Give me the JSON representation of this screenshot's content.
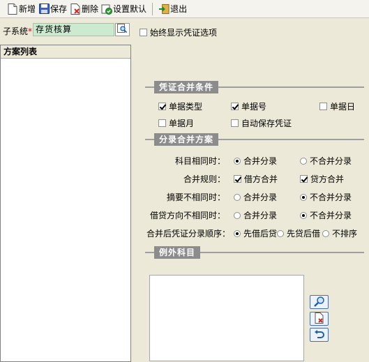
{
  "toolbar": {
    "new_label": "新增",
    "save_label": "保存",
    "delete_label": "删除",
    "set_default_label": "设置默认",
    "exit_label": "退出"
  },
  "subsystem": {
    "label": "子系统",
    "required_mark": "*",
    "value": "存货核算"
  },
  "always_show": {
    "label": "始终显示凭证选项",
    "checked": false
  },
  "plan_list": {
    "header": "方案列表",
    "items": []
  },
  "merge_conditions": {
    "title": "凭证合并条件",
    "doc_type": {
      "label": "单据类型",
      "checked": true
    },
    "doc_no": {
      "label": "单据号",
      "checked": true
    },
    "doc_day": {
      "label": "单据日",
      "checked": false
    },
    "doc_month": {
      "label": "单据月",
      "checked": false
    },
    "auto_save": {
      "label": "自动保存凭证",
      "checked": false
    }
  },
  "entry_merge": {
    "title": "分录合并方案",
    "same_subject": {
      "label": "科目相同时：",
      "opt1": "合并分录",
      "opt2": "不合并分录",
      "selected": 1
    },
    "merge_rule": {
      "label": "合并规则：",
      "debit_label": "借方合并",
      "debit_checked": true,
      "credit_label": "贷方合并",
      "credit_checked": true
    },
    "summary_diff": {
      "label": "摘要不相同时：",
      "opt1": "合并分录",
      "opt2": "不合并分录",
      "selected": 2
    },
    "direction_diff": {
      "label": "借贷方向不相同时：",
      "opt1": "合并分录",
      "opt2": "不合并分录",
      "selected": 2
    },
    "order": {
      "label": "合并后凭证分录顺序：",
      "opt1": "先借后贷",
      "opt2": "先贷后借",
      "opt3": "不排序",
      "selected": 1
    }
  },
  "exceptions": {
    "title": "例外科目",
    "items": []
  }
}
